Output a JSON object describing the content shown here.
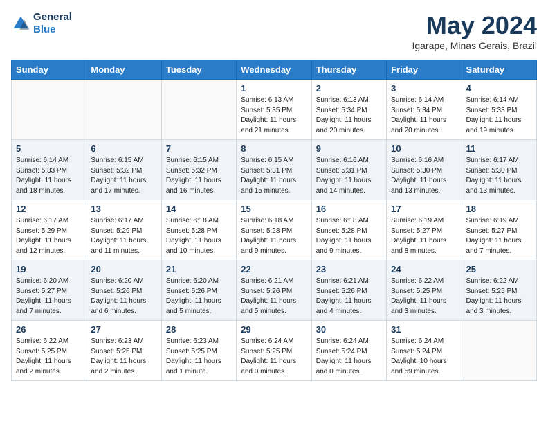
{
  "header": {
    "logo_line1": "General",
    "logo_line2": "Blue",
    "month_title": "May 2024",
    "location": "Igarape, Minas Gerais, Brazil"
  },
  "weekdays": [
    "Sunday",
    "Monday",
    "Tuesday",
    "Wednesday",
    "Thursday",
    "Friday",
    "Saturday"
  ],
  "weeks": [
    [
      {
        "day": "",
        "info": ""
      },
      {
        "day": "",
        "info": ""
      },
      {
        "day": "",
        "info": ""
      },
      {
        "day": "1",
        "info": "Sunrise: 6:13 AM\nSunset: 5:35 PM\nDaylight: 11 hours\nand 21 minutes."
      },
      {
        "day": "2",
        "info": "Sunrise: 6:13 AM\nSunset: 5:34 PM\nDaylight: 11 hours\nand 20 minutes."
      },
      {
        "day": "3",
        "info": "Sunrise: 6:14 AM\nSunset: 5:34 PM\nDaylight: 11 hours\nand 20 minutes."
      },
      {
        "day": "4",
        "info": "Sunrise: 6:14 AM\nSunset: 5:33 PM\nDaylight: 11 hours\nand 19 minutes."
      }
    ],
    [
      {
        "day": "5",
        "info": "Sunrise: 6:14 AM\nSunset: 5:33 PM\nDaylight: 11 hours\nand 18 minutes."
      },
      {
        "day": "6",
        "info": "Sunrise: 6:15 AM\nSunset: 5:32 PM\nDaylight: 11 hours\nand 17 minutes."
      },
      {
        "day": "7",
        "info": "Sunrise: 6:15 AM\nSunset: 5:32 PM\nDaylight: 11 hours\nand 16 minutes."
      },
      {
        "day": "8",
        "info": "Sunrise: 6:15 AM\nSunset: 5:31 PM\nDaylight: 11 hours\nand 15 minutes."
      },
      {
        "day": "9",
        "info": "Sunrise: 6:16 AM\nSunset: 5:31 PM\nDaylight: 11 hours\nand 14 minutes."
      },
      {
        "day": "10",
        "info": "Sunrise: 6:16 AM\nSunset: 5:30 PM\nDaylight: 11 hours\nand 13 minutes."
      },
      {
        "day": "11",
        "info": "Sunrise: 6:17 AM\nSunset: 5:30 PM\nDaylight: 11 hours\nand 13 minutes."
      }
    ],
    [
      {
        "day": "12",
        "info": "Sunrise: 6:17 AM\nSunset: 5:29 PM\nDaylight: 11 hours\nand 12 minutes."
      },
      {
        "day": "13",
        "info": "Sunrise: 6:17 AM\nSunset: 5:29 PM\nDaylight: 11 hours\nand 11 minutes."
      },
      {
        "day": "14",
        "info": "Sunrise: 6:18 AM\nSunset: 5:28 PM\nDaylight: 11 hours\nand 10 minutes."
      },
      {
        "day": "15",
        "info": "Sunrise: 6:18 AM\nSunset: 5:28 PM\nDaylight: 11 hours\nand 9 minutes."
      },
      {
        "day": "16",
        "info": "Sunrise: 6:18 AM\nSunset: 5:28 PM\nDaylight: 11 hours\nand 9 minutes."
      },
      {
        "day": "17",
        "info": "Sunrise: 6:19 AM\nSunset: 5:27 PM\nDaylight: 11 hours\nand 8 minutes."
      },
      {
        "day": "18",
        "info": "Sunrise: 6:19 AM\nSunset: 5:27 PM\nDaylight: 11 hours\nand 7 minutes."
      }
    ],
    [
      {
        "day": "19",
        "info": "Sunrise: 6:20 AM\nSunset: 5:27 PM\nDaylight: 11 hours\nand 7 minutes."
      },
      {
        "day": "20",
        "info": "Sunrise: 6:20 AM\nSunset: 5:26 PM\nDaylight: 11 hours\nand 6 minutes."
      },
      {
        "day": "21",
        "info": "Sunrise: 6:20 AM\nSunset: 5:26 PM\nDaylight: 11 hours\nand 5 minutes."
      },
      {
        "day": "22",
        "info": "Sunrise: 6:21 AM\nSunset: 5:26 PM\nDaylight: 11 hours\nand 5 minutes."
      },
      {
        "day": "23",
        "info": "Sunrise: 6:21 AM\nSunset: 5:26 PM\nDaylight: 11 hours\nand 4 minutes."
      },
      {
        "day": "24",
        "info": "Sunrise: 6:22 AM\nSunset: 5:25 PM\nDaylight: 11 hours\nand 3 minutes."
      },
      {
        "day": "25",
        "info": "Sunrise: 6:22 AM\nSunset: 5:25 PM\nDaylight: 11 hours\nand 3 minutes."
      }
    ],
    [
      {
        "day": "26",
        "info": "Sunrise: 6:22 AM\nSunset: 5:25 PM\nDaylight: 11 hours\nand 2 minutes."
      },
      {
        "day": "27",
        "info": "Sunrise: 6:23 AM\nSunset: 5:25 PM\nDaylight: 11 hours\nand 2 minutes."
      },
      {
        "day": "28",
        "info": "Sunrise: 6:23 AM\nSunset: 5:25 PM\nDaylight: 11 hours\nand 1 minute."
      },
      {
        "day": "29",
        "info": "Sunrise: 6:24 AM\nSunset: 5:25 PM\nDaylight: 11 hours\nand 0 minutes."
      },
      {
        "day": "30",
        "info": "Sunrise: 6:24 AM\nSunset: 5:24 PM\nDaylight: 11 hours\nand 0 minutes."
      },
      {
        "day": "31",
        "info": "Sunrise: 6:24 AM\nSunset: 5:24 PM\nDaylight: 10 hours\nand 59 minutes."
      },
      {
        "day": "",
        "info": ""
      }
    ]
  ]
}
